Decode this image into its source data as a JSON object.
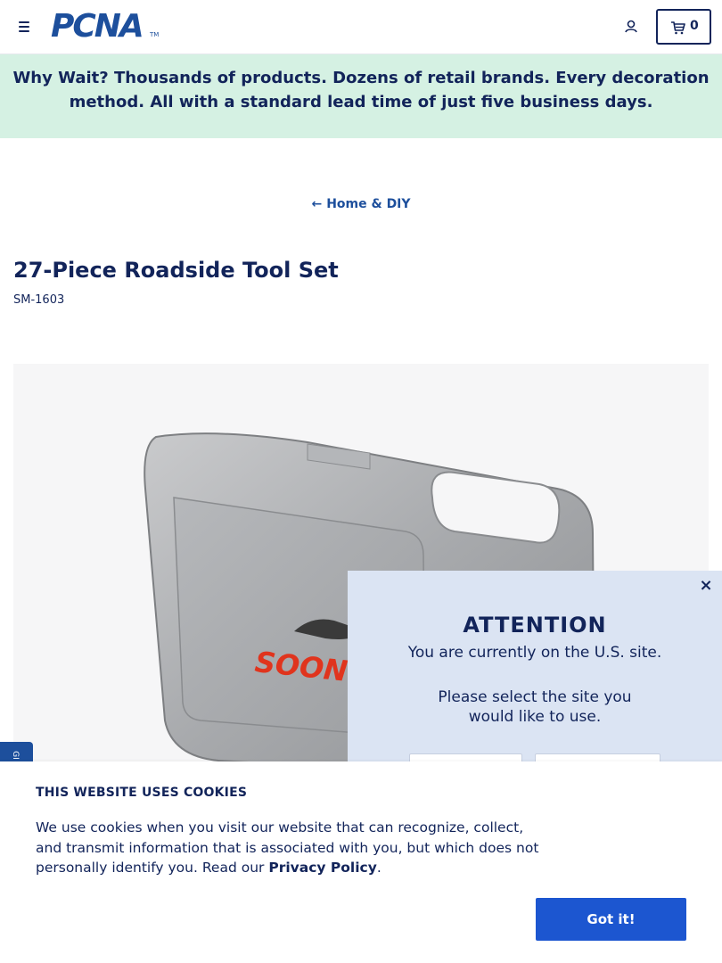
{
  "header": {
    "logo_text": "PCNA",
    "logo_tm": "TM",
    "cart_count": "0",
    "menu_icon": "hamburger-menu-icon",
    "account_icon": "user-icon",
    "cart_icon": "cart-icon"
  },
  "promo": {
    "lead": "Why Wait?",
    "text": "Thousands of products. Dozens of retail brands. Every decoration method. All with a standard lead time of just five business days."
  },
  "breadcrumb": {
    "arrow": "←",
    "label": "Home & DIY"
  },
  "product": {
    "title": "27-Piece Roadside Tool Set",
    "sku": "SM-1603",
    "image_brand_text": "SOONER"
  },
  "geo_tab": {
    "label": "GI"
  },
  "attention": {
    "close": "×",
    "heading": "ATTENTION",
    "subtext": "You are currently on the U.S. site.",
    "prompt": "Please select the site you would like to use."
  },
  "cookie": {
    "title": "THIS WEBSITE USES COOKIES",
    "text_before": "We use cookies when you visit our website that can recognize, collect, and transmit information that is associated with you, but which does not personally identify you. Read our ",
    "link": "Privacy Policy",
    "text_after": ".",
    "button": "Got it!"
  },
  "colors": {
    "navy": "#12245a",
    "brand_blue": "#1d4f9c",
    "promo_bg": "#d5f1e3",
    "popup_bg": "#dbe4f3",
    "button_blue": "#1c56d0"
  }
}
